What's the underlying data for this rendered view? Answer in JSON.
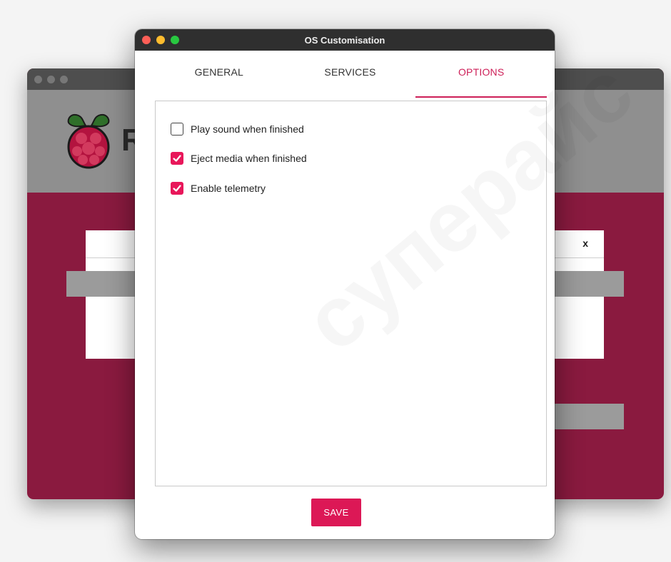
{
  "window": {
    "title": "OS Customisation"
  },
  "tabs": [
    {
      "label": "GENERAL",
      "active": false
    },
    {
      "label": "SERVICES",
      "active": false
    },
    {
      "label": "OPTIONS",
      "active": true
    }
  ],
  "options": [
    {
      "label": "Play sound when finished",
      "checked": false
    },
    {
      "label": "Eject media when finished",
      "checked": true
    },
    {
      "label": "Enable telemetry",
      "checked": true
    }
  ],
  "save_label": "SAVE",
  "background_app": {
    "logo_letter": "R",
    "dialog_close_label": "x"
  },
  "watermark_text": "суперайс",
  "colors": {
    "accent": "#dc1856",
    "checkbox_checked": "#e8175a",
    "tab_active": "#cd1f58",
    "titlebar": "#2f2f2f",
    "background_app": "#8a1a3f"
  }
}
